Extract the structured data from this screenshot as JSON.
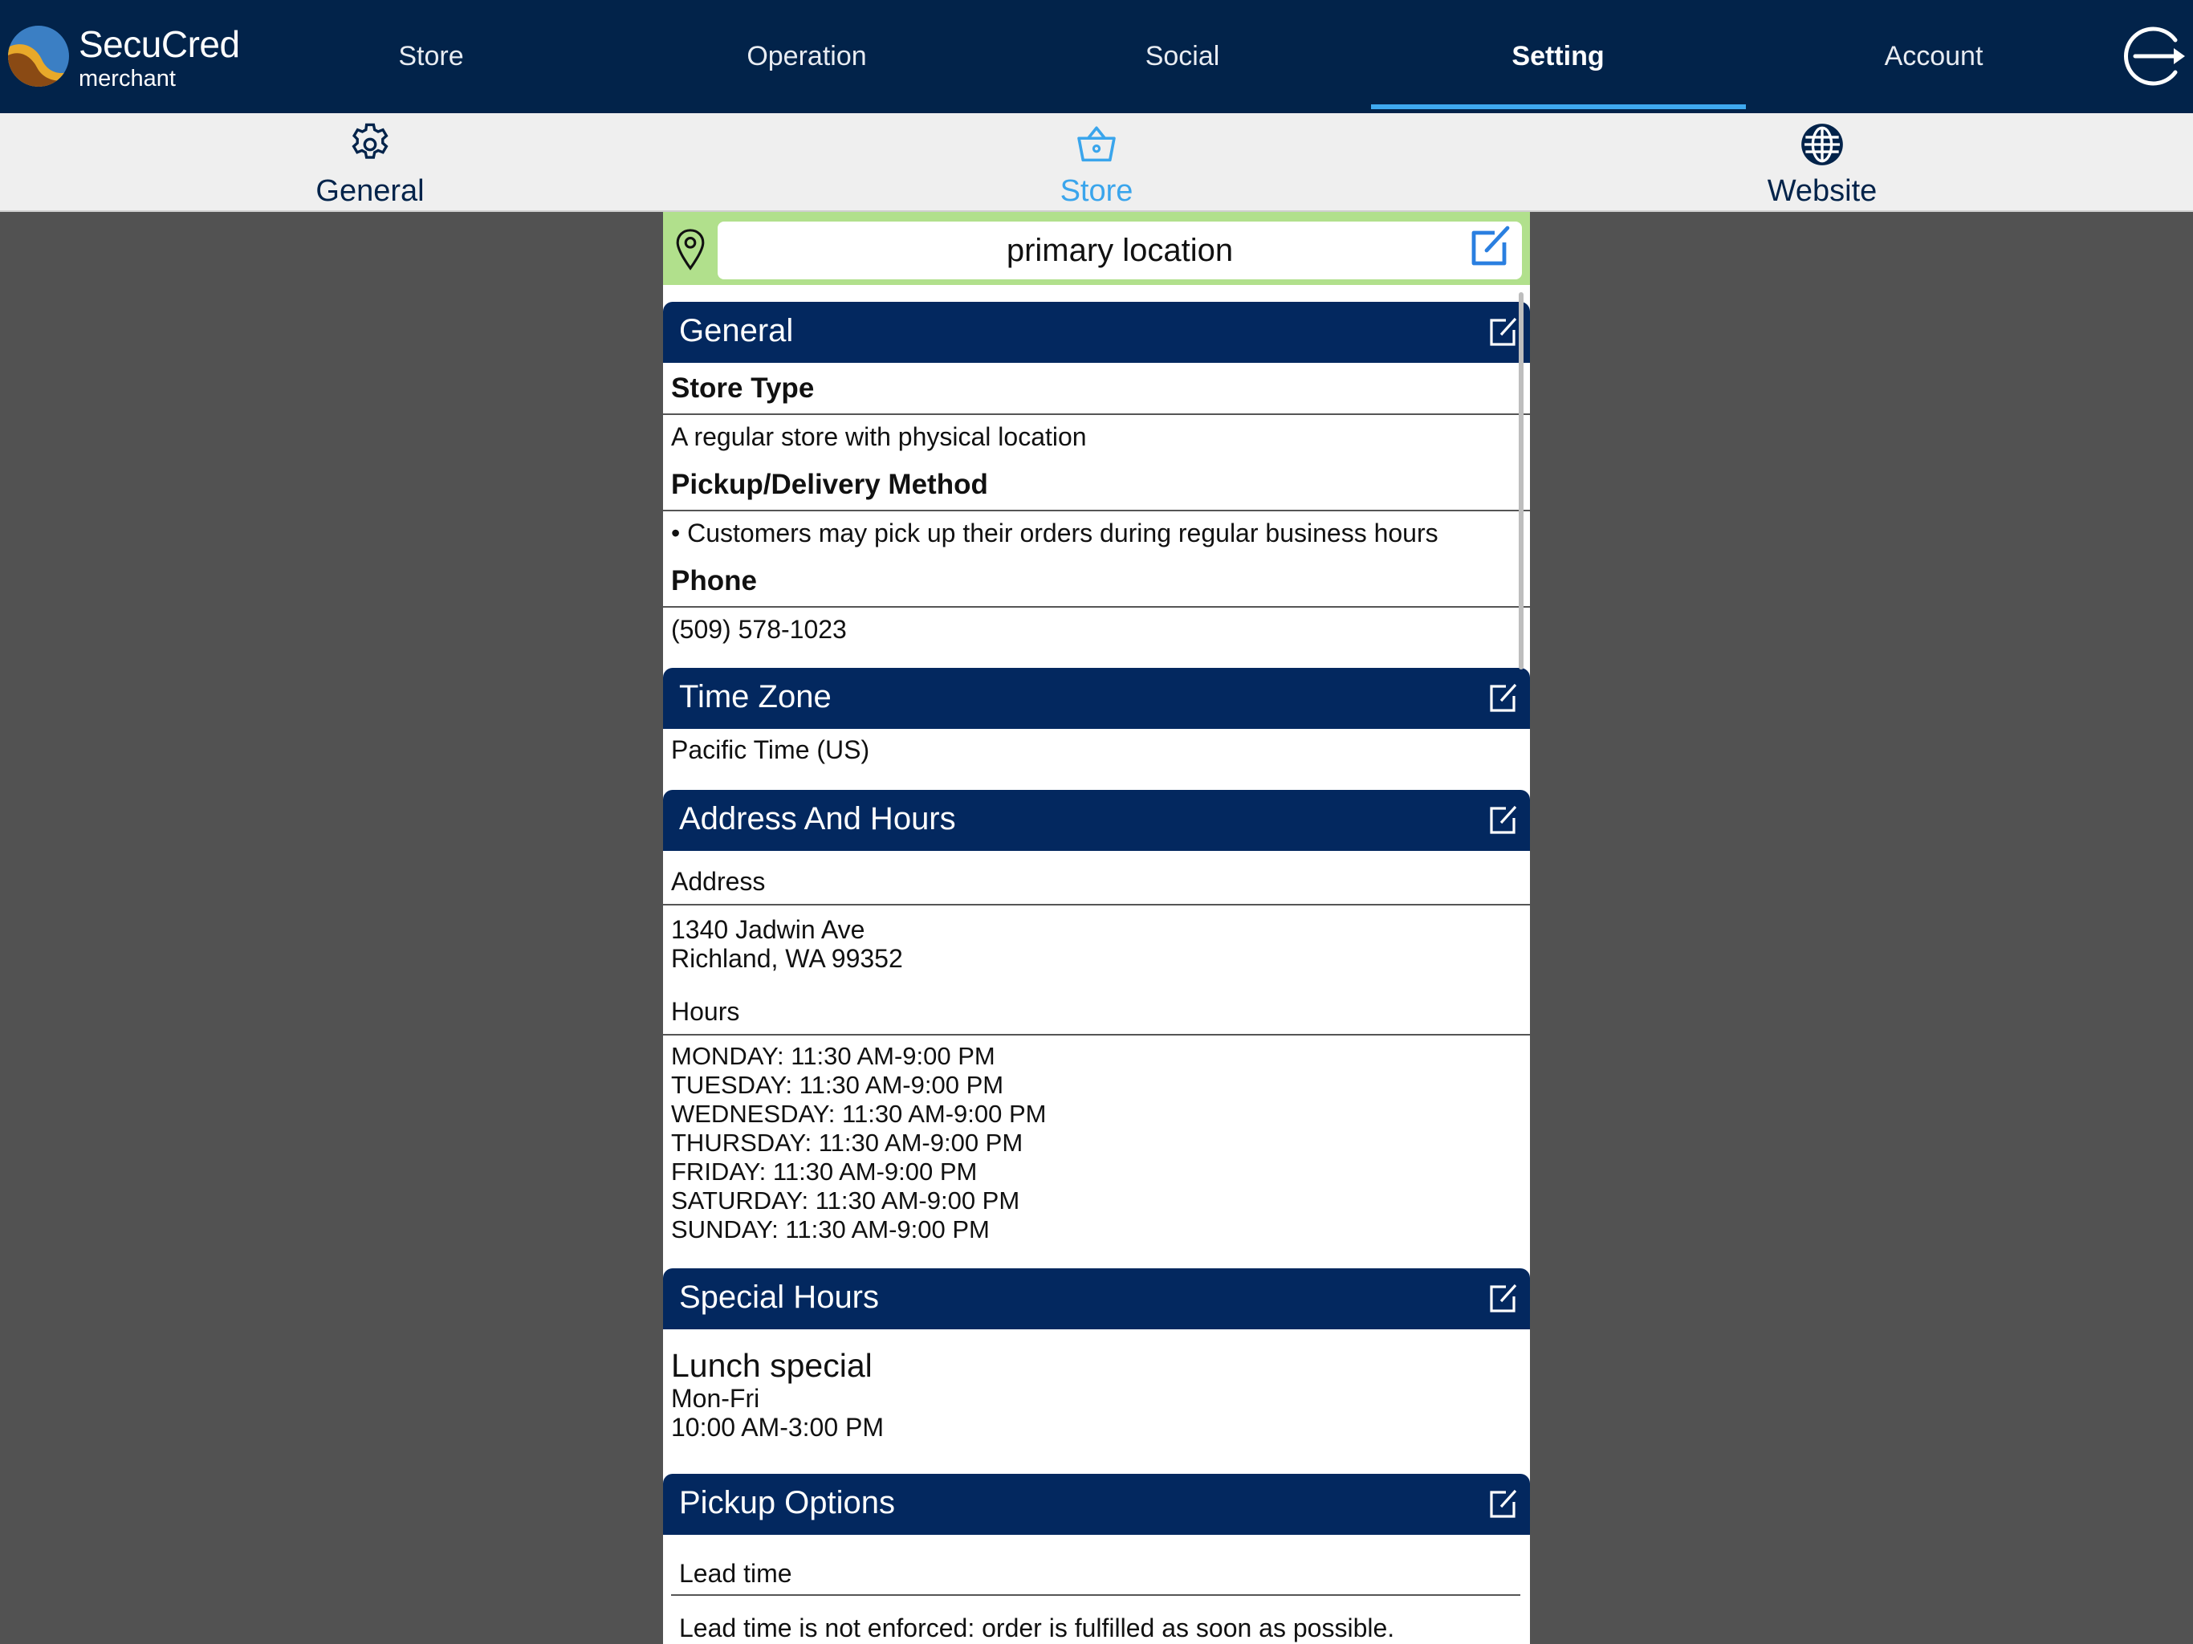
{
  "app": {
    "brand_name": "SecuCred",
    "brand_sub": "merchant"
  },
  "nav": {
    "items": [
      {
        "label": "Store"
      },
      {
        "label": "Operation"
      },
      {
        "label": "Social"
      },
      {
        "label": "Setting",
        "active": true
      },
      {
        "label": "Account"
      }
    ],
    "logout_icon": "logout-icon"
  },
  "subtabs": {
    "items": [
      {
        "label": "General",
        "icon": "gear-icon"
      },
      {
        "label": "Store",
        "icon": "basket-icon",
        "active": true
      },
      {
        "label": "Website",
        "icon": "globe-icon"
      }
    ]
  },
  "location": {
    "name": "primary location",
    "pin_icon": "location-pin-icon",
    "edit_icon": "edit-icon"
  },
  "sections": {
    "general": {
      "title": "General",
      "store_type_label": "Store Type",
      "store_type_value": "A regular store with physical location",
      "pickup_label": "Pickup/Delivery Method",
      "pickup_value": "• Customers may pick up their orders during regular business hours",
      "phone_label": "Phone",
      "phone_value": "(509) 578-1023"
    },
    "timezone": {
      "title": "Time Zone",
      "value": "Pacific Time (US)"
    },
    "address_hours": {
      "title": "Address And Hours",
      "address_label": "Address",
      "address_line1": "1340 Jadwin Ave",
      "address_line2": "Richland, WA 99352",
      "hours_label": "Hours",
      "hours": [
        "MONDAY: 11:30 AM-9:00 PM",
        "TUESDAY: 11:30 AM-9:00 PM",
        "WEDNESDAY: 11:30 AM-9:00 PM",
        "THURSDAY: 11:30 AM-9:00 PM",
        "FRIDAY: 11:30 AM-9:00 PM",
        "SATURDAY: 11:30 AM-9:00 PM",
        "SUNDAY: 11:30 AM-9:00 PM"
      ]
    },
    "special_hours": {
      "title": "Special Hours",
      "name": "Lunch special",
      "days": "Mon-Fri",
      "time": "10:00 AM-3:00 PM"
    },
    "pickup_options": {
      "title": "Pickup Options",
      "lead_time_label": "Lead time",
      "lead_time_value": "Lead time is not enforced: order is fulfilled as soon as possible."
    }
  },
  "colors": {
    "nav_bg": "#02234a",
    "accent": "#3aa5ec",
    "section_header": "#03285f",
    "location_bar": "#b1e08c",
    "backdrop": "#525252"
  }
}
